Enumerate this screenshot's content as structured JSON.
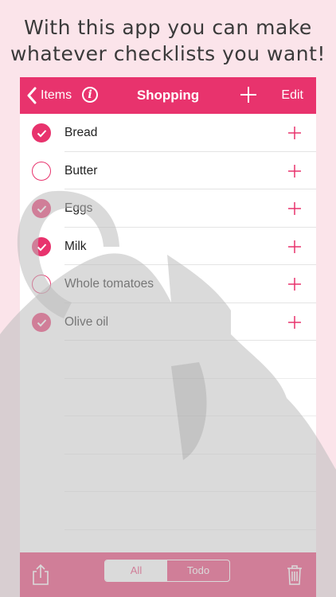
{
  "caption": {
    "line1": "With this app you can make",
    "line2": "whatever checklists you want!"
  },
  "navbar": {
    "back_label": "Items",
    "info_icon": "i",
    "title": "Shopping",
    "edit_label": "Edit"
  },
  "items": [
    {
      "label": "Bread",
      "checked": true
    },
    {
      "label": "Butter",
      "checked": false
    },
    {
      "label": "Eggs",
      "checked": true
    },
    {
      "label": "Milk",
      "checked": true
    },
    {
      "label": "Whole tomatoes",
      "checked": false
    },
    {
      "label": "Olive oil",
      "checked": true
    }
  ],
  "toolbar": {
    "seg_all": "All",
    "seg_todo": "Todo"
  },
  "colors": {
    "accent": "#e8336d",
    "background": "#fbe4ea"
  }
}
